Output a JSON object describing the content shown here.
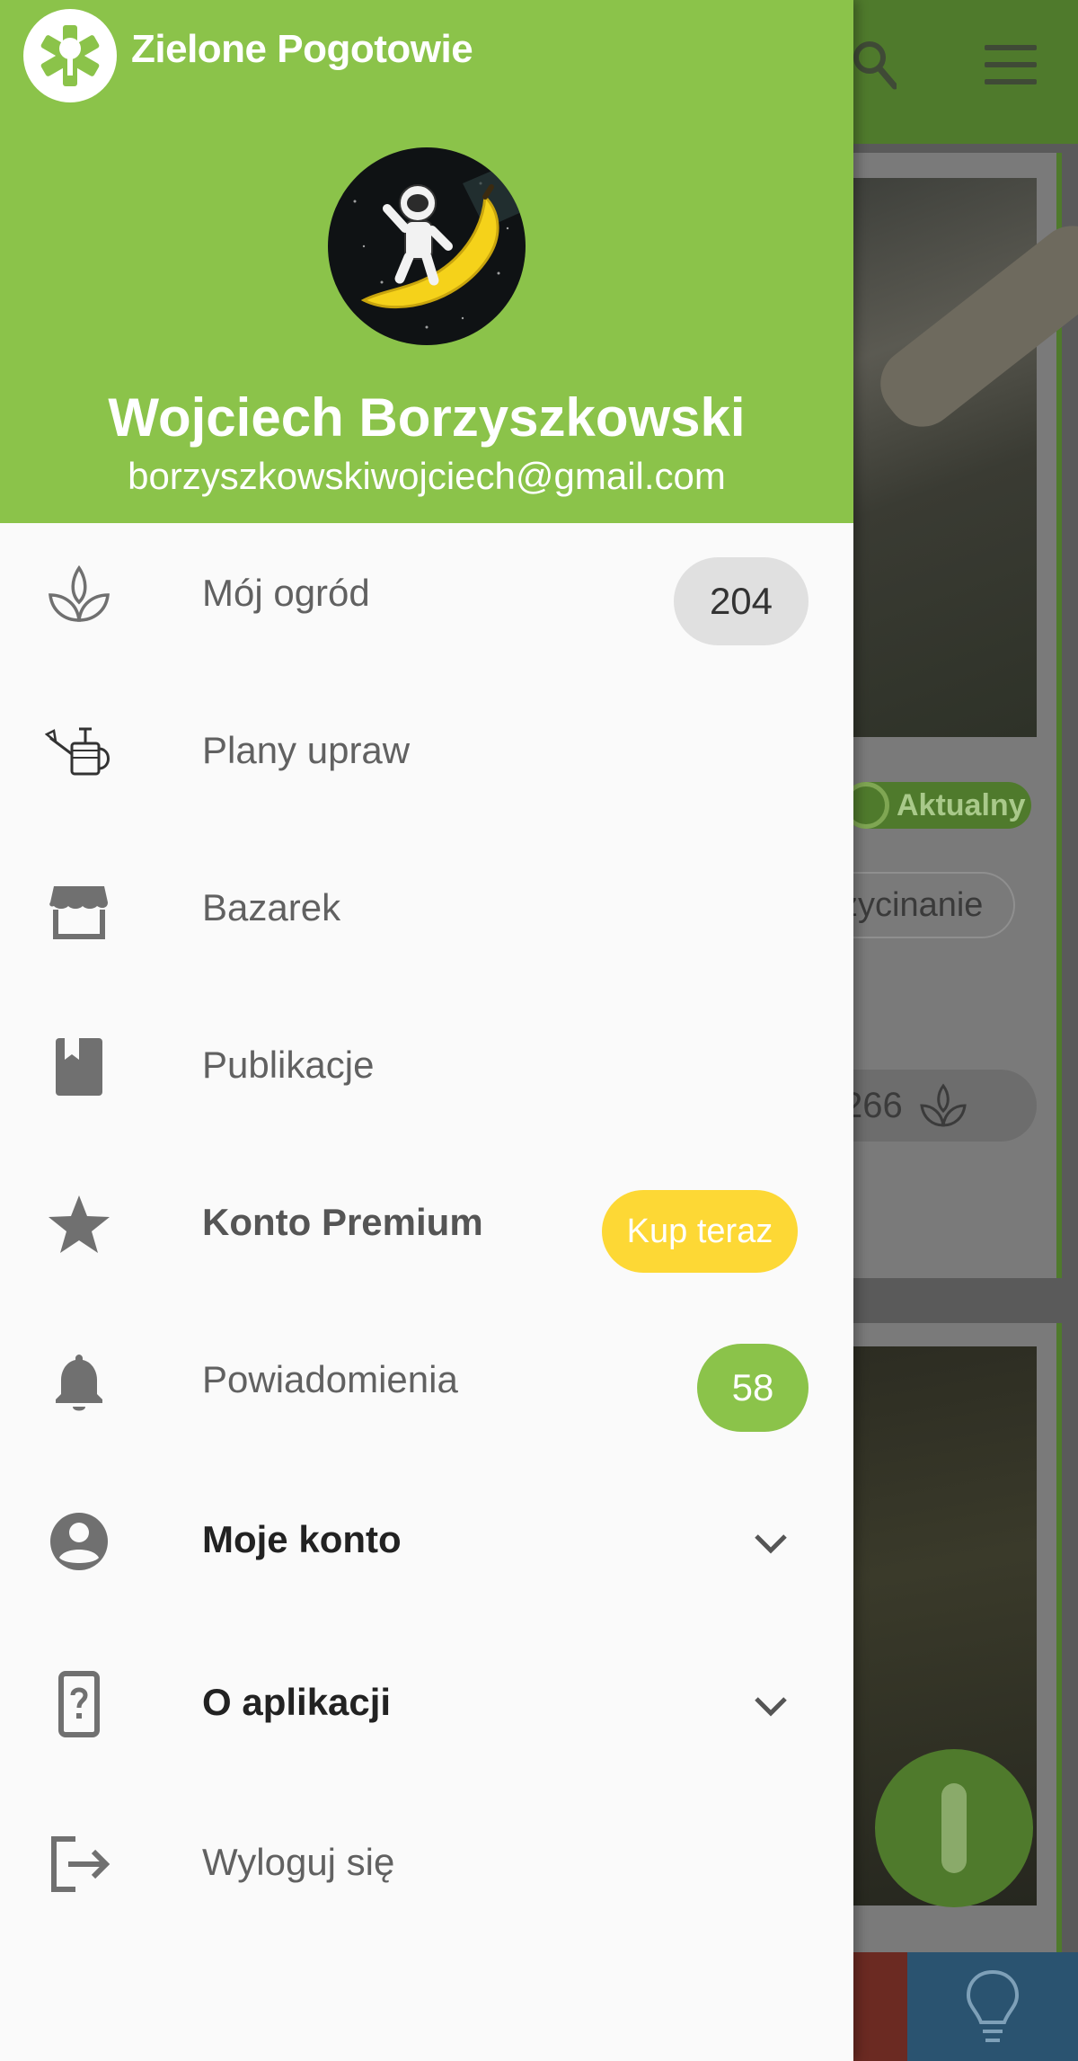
{
  "app": {
    "title": "Zielone Pogotowie"
  },
  "user": {
    "name": "Wojciech Borzyszkowski",
    "email": "borzyszkowskiwojciech@gmail.com"
  },
  "menu": [
    {
      "label": "Mój ogród",
      "icon": "plant-leaves-icon",
      "badge": "204"
    },
    {
      "label": "Plany upraw",
      "icon": "watering-can-icon"
    },
    {
      "label": "Bazarek",
      "icon": "store-icon"
    },
    {
      "label": "Publikacje",
      "icon": "book-icon"
    },
    {
      "label": "Konto Premium",
      "icon": "star-icon",
      "action": "Kup teraz"
    },
    {
      "label": "Powiadomienia",
      "icon": "bell-icon",
      "badge": "58"
    },
    {
      "label": "Moje konto",
      "icon": "account-circle-icon",
      "expandable": true
    },
    {
      "label": "O aplikacji",
      "icon": "phone-question-icon",
      "expandable": true
    },
    {
      "label": "Wyloguj się",
      "icon": "logout-icon"
    }
  ],
  "background": {
    "status_badge": "Aktualny",
    "tag_chip": "zycinanie",
    "plant_count": "266"
  },
  "colors": {
    "primary_green": "#8bc34a",
    "premium_yellow": "#fdd835",
    "drawer_bg": "#fafafa"
  }
}
